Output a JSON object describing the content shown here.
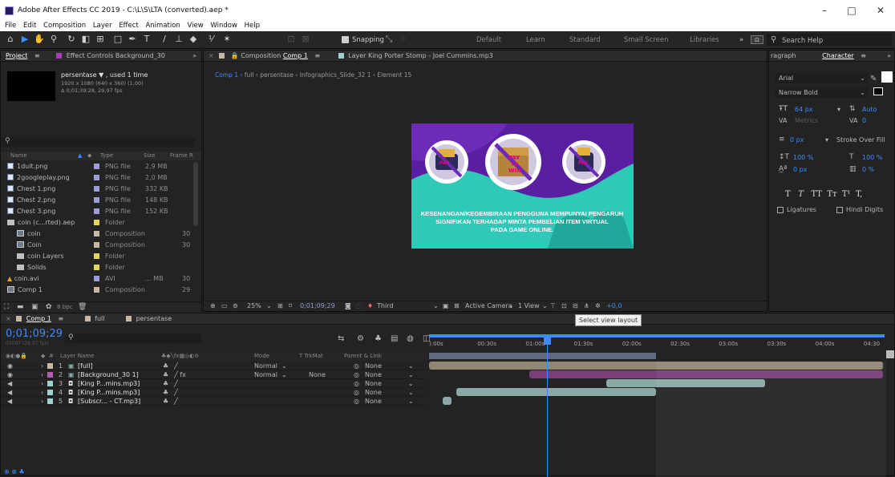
{
  "window": {
    "title": "Adobe After Effects CC 2019 - C:\\L\\S\\LTA (converted).aep *",
    "minimize": "–",
    "maximize": "□",
    "close": "✕"
  },
  "menu": [
    "File",
    "Edit",
    "Composition",
    "Layer",
    "Effect",
    "Animation",
    "View",
    "Window",
    "Help"
  ],
  "toolbar": {
    "snapping": "Snapping",
    "workspaces": [
      "Default",
      "Learn",
      "Standard",
      "Small Screen",
      "Libraries"
    ],
    "more": "»",
    "search_placeholder": "Search Help"
  },
  "project": {
    "tab": "Project",
    "menu_icon": "≡",
    "effect_controls": "Effect Controls Background_30",
    "more": "»",
    "info_name": "persentase ▼ , used 1 time",
    "info_dims": "1920 x 1080  (640 x 360) (1,00)",
    "info_dur": "Δ 0;01;39;28, 29,97 fps",
    "columns": [
      "Name",
      "Type",
      "Size",
      "Frame R"
    ],
    "items": [
      {
        "name": "1duit.png",
        "type": "PNG file",
        "size": "2,9 MB",
        "fr": "",
        "icon": "file",
        "color": "#9d9dd8",
        "indent": 0
      },
      {
        "name": "2googleplay.png",
        "type": "PNG file",
        "size": "2,0 MB",
        "fr": "",
        "icon": "file",
        "color": "#9d9dd8",
        "indent": 0
      },
      {
        "name": "Chest 1.png",
        "type": "PNG file",
        "size": "332 KB",
        "fr": "",
        "icon": "file",
        "color": "#9d9dd8",
        "indent": 0
      },
      {
        "name": "Chest 2.png",
        "type": "PNG file",
        "size": "148 KB",
        "fr": "",
        "icon": "file",
        "color": "#9d9dd8",
        "indent": 0
      },
      {
        "name": "Chest 3.png",
        "type": "PNG file",
        "size": "152 KB",
        "fr": "",
        "icon": "file",
        "color": "#9d9dd8",
        "indent": 0
      },
      {
        "name": "coin (c...rted).aep",
        "type": "Folder",
        "size": "",
        "fr": "",
        "icon": "folder",
        "color": "#e3d55a",
        "indent": 0
      },
      {
        "name": "coin",
        "type": "Composition",
        "size": "",
        "fr": "30",
        "icon": "comp",
        "color": "#c9b7a6",
        "indent": 1
      },
      {
        "name": "Coin",
        "type": "Composition",
        "size": "",
        "fr": "30",
        "icon": "comp",
        "color": "#c9b7a6",
        "indent": 1
      },
      {
        "name": "coin Layers",
        "type": "Folder",
        "size": "",
        "fr": "",
        "icon": "folder",
        "color": "#e3d55a",
        "indent": 1
      },
      {
        "name": "Solids",
        "type": "Folder",
        "size": "",
        "fr": "",
        "icon": "folder",
        "color": "#e3d55a",
        "indent": 1
      },
      {
        "name": "coin.avi",
        "type": "AVI",
        "size": "... MB",
        "fr": "30",
        "icon": "avi",
        "color": "#9d9dd8",
        "indent": 0
      },
      {
        "name": "Comp 1",
        "type": "Composition",
        "size": "",
        "fr": "29",
        "icon": "comp",
        "color": "#c9b7a6",
        "indent": 0
      }
    ],
    "bpc": "8 bpc"
  },
  "viewer": {
    "comp_tab": "Composition",
    "comp_name": "Comp 1",
    "layer_tab": "Layer King Porter Stomp - Joel Cummins.mp3",
    "breadcrumbs": [
      "Comp 1",
      "full",
      "persentase",
      "Infographics_Slide_32 1",
      "Element 15"
    ],
    "zoom": "25%",
    "timecode": "0;01;09;29",
    "resolution": "Third",
    "camera": "Active Camera",
    "view": "1 View",
    "exposure": "+0,0",
    "tooltip": "Select view layout",
    "slide_text": [
      "KESENANGAN/KEGEMBIRAAN PENGGUNA MEMPUNYAI PENGARUH",
      "SIGNIFIKAN TERHADAP MINTA PEMBELIAN ITEM VIRTUAL",
      "PADA GAME ONLINE."
    ],
    "sign_text": [
      "PAY",
      "TO",
      "WIN"
    ]
  },
  "character": {
    "tab_left": "ragraph",
    "tab": "Character",
    "font": "Arial",
    "style": "Narrow Bold",
    "size": "64 px",
    "leading": "Auto",
    "kerning": "Metrics",
    "tracking": "0",
    "stroke_size": "0 px",
    "stroke_mode": "Stroke Over Fill",
    "vscale": "100 %",
    "hscale": "100 %",
    "baseline": "0 px",
    "tsume": "0 %",
    "styles": [
      "T",
      "T",
      "TT",
      "Tт",
      "T¹",
      "T,"
    ],
    "ligatures": "Ligatures",
    "hindi": "Hindi Digits"
  },
  "timeline": {
    "tabs": [
      "Comp 1",
      "full",
      "persentase"
    ],
    "timecode": "0;01;09;29",
    "frame_info": "02097 (29.97 fps)",
    "columns": {
      "layer": "Layer Name",
      "mode": "Mode",
      "trkmat": "T  TrkMat",
      "parent": "Parent & Link"
    },
    "ruler": [
      "):00s",
      "00:30s",
      "01:00s",
      "01:30s",
      "02:00s",
      "02:30s",
      "03:00s",
      "03:30s",
      "04:00s",
      "04:30"
    ],
    "layers": [
      {
        "num": "1",
        "name": "[full]",
        "mode": "Normal",
        "trkmat": "",
        "parent": "None",
        "color": "#c9b7a6",
        "type": "comp",
        "bar_start": 0,
        "bar_end": 1
      },
      {
        "num": "2",
        "name": "[Background_30 1]",
        "mode": "Normal",
        "trkmat": "None",
        "parent": "None",
        "color": "#b25fb2",
        "type": "comp",
        "bar_start": 0.22,
        "bar_end": 1
      },
      {
        "num": "3",
        "name": "[King P...mins.mp3]",
        "mode": "",
        "trkmat": "",
        "parent": "None",
        "color": "#9dd0cf",
        "type": "audio",
        "bar_start": 0.39,
        "bar_end": 0.74
      },
      {
        "num": "4",
        "name": "[King P...mins.mp3]",
        "mode": "",
        "trkmat": "",
        "parent": "None",
        "color": "#9dd0cf",
        "type": "audio",
        "bar_start": 0.06,
        "bar_end": 0.5
      },
      {
        "num": "5",
        "name": "[Subscr... - CT.mp3]",
        "mode": "",
        "trkmat": "",
        "parent": "None",
        "color": "#9dd0cf",
        "type": "audio",
        "bar_start": 0.03,
        "bar_end": 0.05
      }
    ],
    "playhead_fraction": 0.26,
    "workarea_end_fraction": 0.5
  },
  "colors": {
    "teal": "#2fc9b8",
    "purple": "#5a1fa0",
    "accent": "#3d8bff"
  }
}
